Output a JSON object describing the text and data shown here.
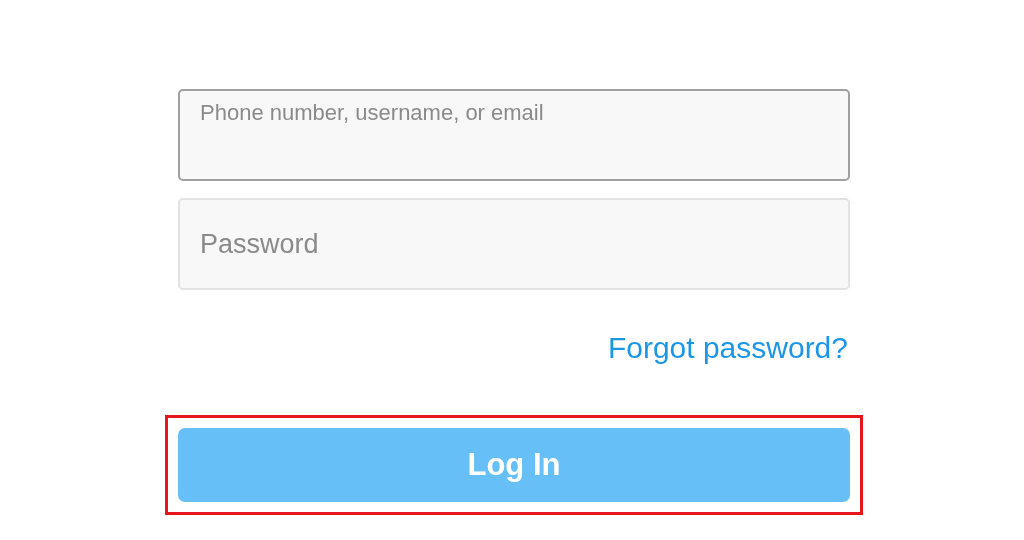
{
  "fields": [
    {
      "placeholder": "Phone number, username, or email",
      "focused": true
    },
    {
      "placeholder": "Password",
      "focused": false
    }
  ],
  "forgot_link": "Forgot password?",
  "login_button": {
    "label": "Log In",
    "highlighted": true
  }
}
